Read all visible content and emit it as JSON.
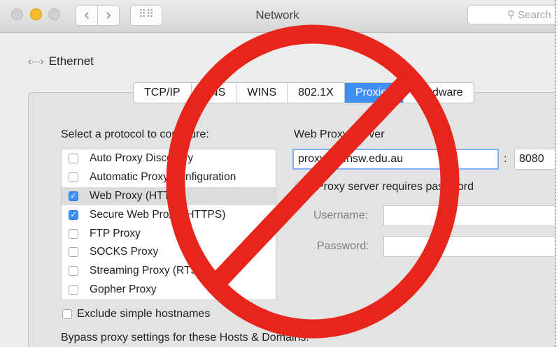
{
  "window": {
    "title": "Network",
    "search_placeholder": "Search"
  },
  "nav": {
    "back_glyph": "‹",
    "forward_glyph": "›",
    "grid_glyph": "⠿⠿"
  },
  "service": {
    "icon": "‹···›",
    "name": "Ethernet"
  },
  "tabs": [
    {
      "label": "TCP/IP"
    },
    {
      "label": "DNS"
    },
    {
      "label": "WINS"
    },
    {
      "label": "802.1X"
    },
    {
      "label": "Proxies"
    },
    {
      "label": "Hardware"
    }
  ],
  "protocols": {
    "heading": "Select a protocol to configure:",
    "items": [
      {
        "label": "Auto Proxy Discovery",
        "checked": false
      },
      {
        "label": "Automatic Proxy Configuration",
        "checked": false
      },
      {
        "label": "Web Proxy (HTTP)",
        "checked": true
      },
      {
        "label": "Secure Web Proxy (HTTPS)",
        "checked": true
      },
      {
        "label": "FTP Proxy",
        "checked": false
      },
      {
        "label": "SOCKS Proxy",
        "checked": false
      },
      {
        "label": "Streaming Proxy (RTSP)",
        "checked": false
      },
      {
        "label": "Gopher Proxy",
        "checked": false
      }
    ]
  },
  "server": {
    "heading": "Web Proxy Server",
    "host": "proxy.det.nsw.edu.au",
    "colon": ":",
    "port": "8080",
    "requires_password": "Proxy server requires password",
    "username_label": "Username:",
    "password_label": "Password:"
  },
  "exclude_label": "Exclude simple hostnames",
  "bypass_label": "Bypass proxy settings for these Hosts & Domains:",
  "overlay": {
    "symbol": "prohibition-sign",
    "color": "#e8251a"
  }
}
